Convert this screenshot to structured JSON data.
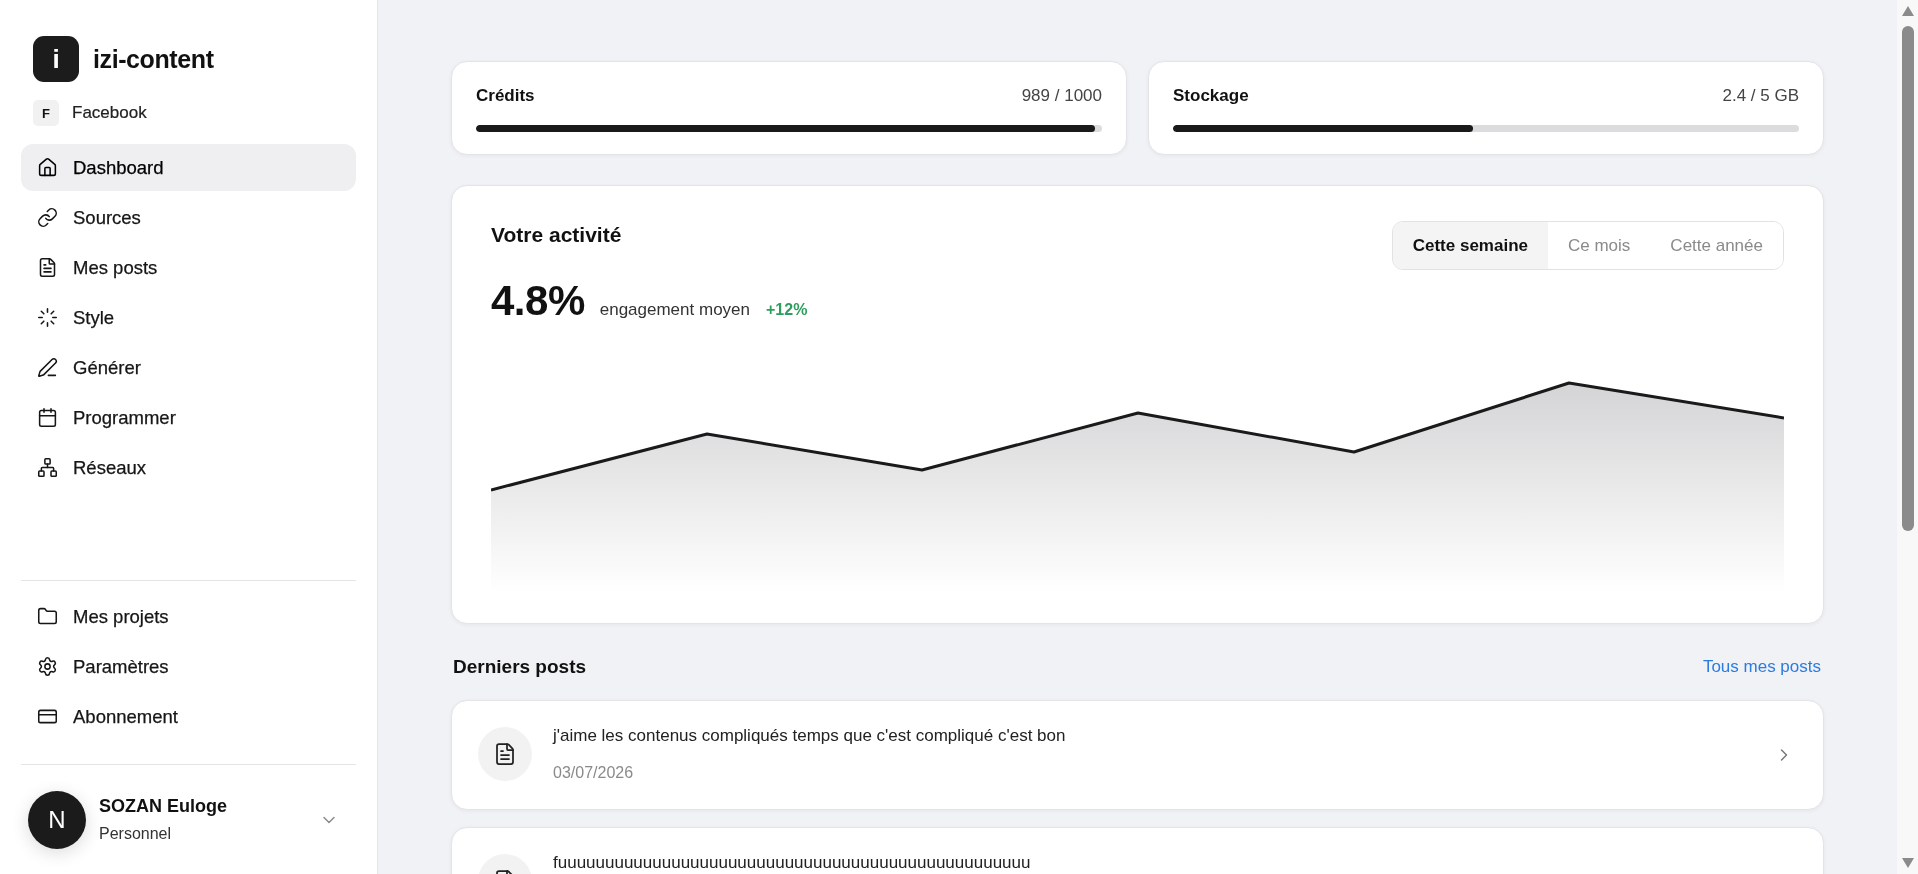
{
  "sidebar": {
    "logo": {
      "letter": "i",
      "name": "izi-content"
    },
    "account": {
      "initial": "F",
      "name": "Facebook"
    },
    "nav": [
      {
        "label": "Dashboard",
        "selected": true
      },
      {
        "label": "Sources",
        "selected": false
      },
      {
        "label": "Mes posts",
        "selected": false
      },
      {
        "label": "Style",
        "selected": false
      },
      {
        "label": "Générer",
        "selected": false
      },
      {
        "label": "Programmer",
        "selected": false
      },
      {
        "label": "Réseaux",
        "selected": false
      }
    ],
    "secondary_nav": [
      {
        "label": "Mes projets",
        "selected": false
      },
      {
        "label": "Paramètres",
        "selected": false
      },
      {
        "label": "Abonnement",
        "selected": false
      }
    ],
    "user": {
      "initial": "N",
      "name": "SOZAN Euloge",
      "plan": "Personnel"
    }
  },
  "usage": [
    {
      "title": "Crédits",
      "reading": "989 / 1000",
      "level": 0.989
    },
    {
      "title": "Stockage",
      "reading": "2.4 / 5 GB",
      "level": 0.48
    }
  ],
  "activity": {
    "title": "Votre activité",
    "value": "4.8%",
    "caption": "engagement moyen",
    "change": "+12%",
    "periods": [
      {
        "label": "Cette semaine",
        "selected": true
      },
      {
        "label": "Ce mois",
        "selected": false
      },
      {
        "label": "Cette année",
        "selected": false
      }
    ]
  },
  "posts": {
    "title": "Derniers posts",
    "link": "Tous mes posts",
    "items": [
      {
        "text": "j'aime les contenus compliqués temps que c'est compliqué c'est bon",
        "date": "03/07/2026"
      },
      {
        "text": "fuuuuuuuuuuuuuuuuuuuuuuuuuuuuuuuuuuuuuuuuuuuuuuuuuu"
      }
    ]
  }
}
